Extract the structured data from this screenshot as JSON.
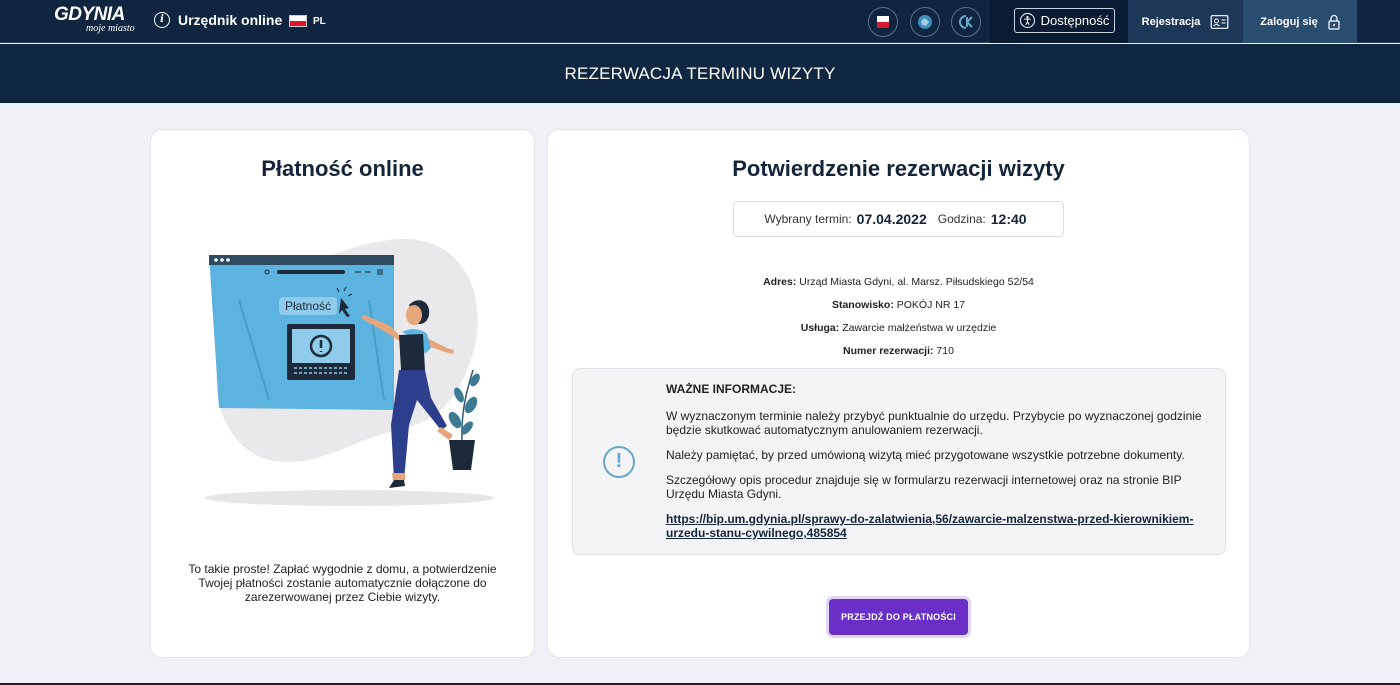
{
  "header": {
    "logo_main": "GDYNIA",
    "logo_sub": "moje miasto",
    "app_title": "Urzędnik online",
    "language": "PL",
    "accessibility_label": "Dostępność",
    "register_label": "Rejestracja",
    "login_label": "Zaloguj się"
  },
  "page_title": "REZERWACJA TERMINU WIZYTY",
  "payment_card": {
    "title": "Płatność online",
    "illustration_label": "Płatność",
    "description": "To takie proste! Zapłać wygodnie z domu, a potwierdzenie Twojej płatności zostanie automatycznie dołączone do zarezerwowanej przez Ciebie wizyty."
  },
  "confirmation_card": {
    "title": "Potwierdzenie rezerwacji wizyty",
    "term_label": "Wybrany termin:",
    "term_date": "07.04.2022",
    "time_label": "Godzina:",
    "time_value": "12:40",
    "details": {
      "address_label": "Adres:",
      "address_value": "Urząd Miasta Gdyni, al. Marsz. Piłsudskiego 52/54",
      "station_label": "Stanowisko:",
      "station_value": "POKÓJ NR 17",
      "service_label": "Usługa:",
      "service_value": "Zawarcie małżeństwa w urzędzie",
      "number_label": "Numer rezerwacji:",
      "number_value": "710"
    },
    "notice": {
      "title": "WAŻNE INFORMACJE:",
      "p1": "W wyznaczonym terminie należy przybyć punktualnie do urzędu. Przybycie po wyznaczonej godzinie będzie skutkować automatycznym anulowaniem rezerwacji.",
      "p2": "Należy pamiętać, by przed umówioną wizytą mieć przygotowane wszystkie potrzebne dokumenty.",
      "p3": "Szczegółowy opis procedur znajduje się w formularzu rezerwacji internetowej oraz na stronie BIP Urzędu Miasta Gdyni.",
      "link": "https://bip.um.gdynia.pl/sprawy-do-zalatwienia,56/zawarcie-malzenstwa-przed-kierownikiem-urzedu-stanu-cywilnego,485854"
    },
    "pay_button": "PRZEJDŹ DO PŁATNOŚCI"
  },
  "colors": {
    "navy": "#0f2540",
    "accent_purple": "#6a2fc7",
    "info_blue": "#6aa6c8",
    "illustration_blue": "#5db3df"
  }
}
